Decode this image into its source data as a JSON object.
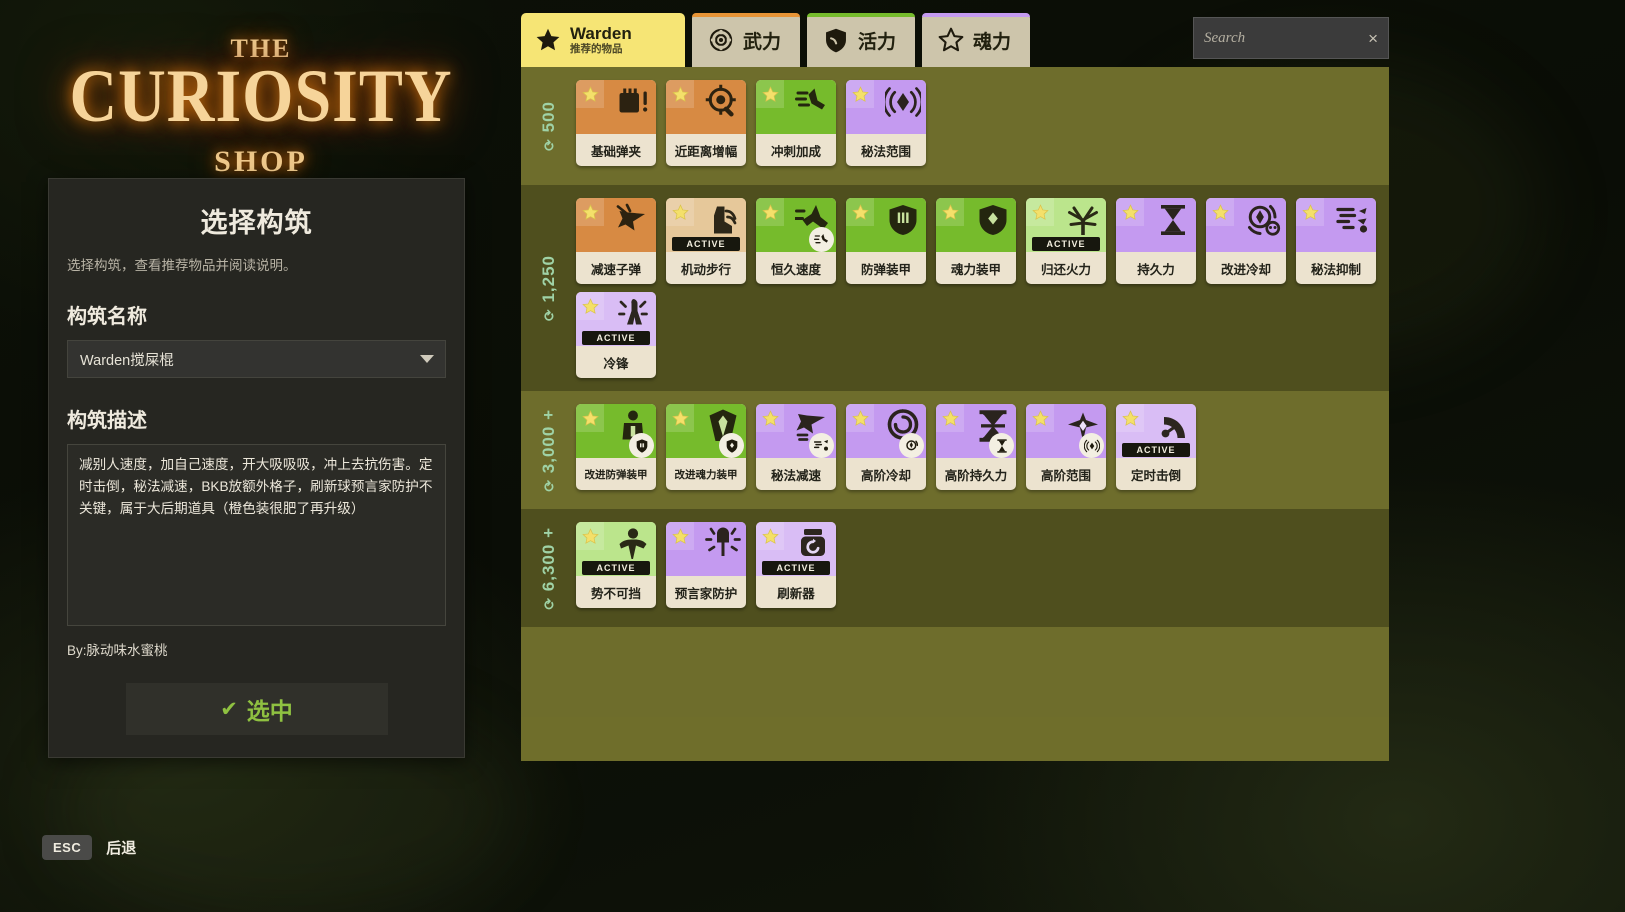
{
  "logo": {
    "line1": "THE",
    "line2": "CURIOSITY",
    "line3": "SHOP"
  },
  "build_panel": {
    "title": "选择构筑",
    "subtitle": "选择构筑，查看推荐物品并阅读说明。",
    "name_label": "构筑名称",
    "name_value": "Warden搅屎棍",
    "desc_label": "构筑描述",
    "desc_value": "减别人速度，加自己速度，开大吸吸吸，冲上去抗伤害。定时击倒，秘法减速，BKB放额外格子，刷新球预言家防护不关键，属于大后期道具（橙色装很肥了再升级）",
    "byline": "By:脉动味水蜜桃",
    "select_button": "选中"
  },
  "footer": {
    "esc_key": "ESC",
    "esc_label": "后退"
  },
  "search": {
    "placeholder": "Search",
    "value": "",
    "clear": "×"
  },
  "tabs": [
    {
      "id": "warden",
      "label": "Warden",
      "sub": "推荐的物品",
      "icon": "star-icon",
      "active": true,
      "accent": "#f6e575"
    },
    {
      "id": "weapon",
      "label": "武力",
      "sub": "",
      "icon": "target-icon",
      "active": false,
      "accent": "#e79436"
    },
    {
      "id": "vitality",
      "label": "活力",
      "sub": "",
      "icon": "shield-icon",
      "active": false,
      "accent": "#76bb2c"
    },
    {
      "id": "spirit",
      "label": "魂力",
      "sub": "",
      "icon": "star-outline-icon",
      "active": false,
      "accent": "#c49af0"
    }
  ],
  "tiers": [
    {
      "price": "500",
      "items": [
        {
          "name": "基础弹夹",
          "color": "weapon",
          "icon": "ammo-clip-icon",
          "active": false,
          "badge": false
        },
        {
          "name": "近距离增幅",
          "color": "weapon",
          "icon": "scope-icon",
          "active": false,
          "badge": false
        },
        {
          "name": "冲刺加成",
          "color": "vitality",
          "icon": "boot-dash-icon",
          "active": false,
          "badge": false
        },
        {
          "name": "秘法范围",
          "color": "spirit",
          "icon": "range-waves-icon",
          "active": false,
          "badge": false
        }
      ]
    },
    {
      "price": "1,250",
      "items": [
        {
          "name": "减速子弹",
          "color": "weapon",
          "icon": "slow-bullet-icon",
          "active": false,
          "badge": false
        },
        {
          "name": "机动步行",
          "color": "weapon-light",
          "icon": "winged-boot-icon",
          "active": true,
          "badge": false
        },
        {
          "name": "恒久速度",
          "color": "vitality",
          "icon": "speed-leg-icon",
          "active": false,
          "badge": true
        },
        {
          "name": "防弹装甲",
          "color": "vitality",
          "icon": "bullet-shield-icon",
          "active": false,
          "badge": false
        },
        {
          "name": "魂力装甲",
          "color": "vitality",
          "icon": "spirit-shield-icon",
          "active": false,
          "badge": false
        },
        {
          "name": "归还火力",
          "color": "vitality-light",
          "icon": "return-fire-icon",
          "active": true,
          "badge": false
        },
        {
          "name": "持久力",
          "color": "spirit",
          "icon": "hourglass-icon",
          "active": false,
          "badge": false
        },
        {
          "name": "改进冷却",
          "color": "spirit",
          "icon": "cooldown-icon",
          "active": false,
          "badge": false
        },
        {
          "name": "秘法抑制",
          "color": "spirit",
          "icon": "suppress-icon",
          "active": false,
          "badge": false
        },
        {
          "name": "冷锋",
          "color": "spirit-light",
          "icon": "cold-front-icon",
          "active": true,
          "badge": false
        }
      ]
    },
    {
      "price": "3,000 +",
      "items": [
        {
          "name": "改进防弹装甲",
          "color": "vitality",
          "icon": "armored-figure-icon",
          "active": false,
          "badge": true
        },
        {
          "name": "改进魂力装甲",
          "color": "vitality",
          "icon": "spirit-armor-icon",
          "active": false,
          "badge": true
        },
        {
          "name": "秘法减速",
          "color": "spirit",
          "icon": "slow-hex-icon",
          "active": false,
          "badge": true
        },
        {
          "name": "高阶冷却",
          "color": "spirit",
          "icon": "swirl-icon",
          "active": false,
          "badge": true
        },
        {
          "name": "高阶持久力",
          "color": "spirit",
          "icon": "big-hourglass-icon",
          "active": false,
          "badge": true
        },
        {
          "name": "高阶范围",
          "color": "spirit",
          "icon": "wings-range-icon",
          "active": false,
          "badge": true
        },
        {
          "name": "定时击倒",
          "color": "spirit-light",
          "icon": "knockdown-icon",
          "active": true,
          "badge": false
        }
      ]
    },
    {
      "price": "6,300 +",
      "items": [
        {
          "name": "势不可挡",
          "color": "vitality-light",
          "icon": "unstoppable-icon",
          "active": true,
          "badge": false
        },
        {
          "name": "预言家防护",
          "color": "spirit",
          "icon": "phantom-strike-icon",
          "active": false,
          "badge": false
        },
        {
          "name": "刷新器",
          "color": "spirit-light",
          "icon": "refresher-icon",
          "active": true,
          "badge": false
        }
      ]
    }
  ],
  "colors": {
    "weapon": "#d78a43",
    "weapon_light": "#e6c89a",
    "vitality": "#76bb2c",
    "vitality_light": "#bbe58c",
    "spirit": "#c49af0",
    "spirit_light": "#d9bdf5",
    "panel_bg": "#6f6e2b",
    "tab_active": "#f6e575",
    "price_text": "#9fd2a6",
    "select_green": "#8fc141"
  }
}
